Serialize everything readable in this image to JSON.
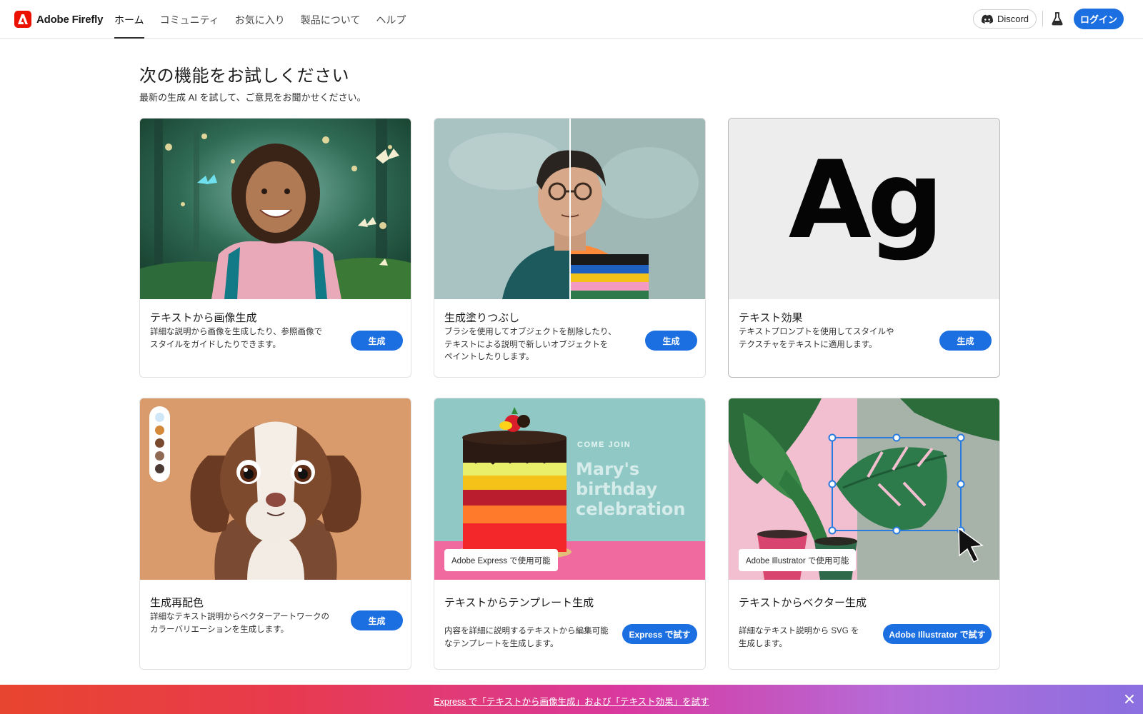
{
  "brand": {
    "name": "Adobe Firefly"
  },
  "nav": {
    "items": [
      {
        "label": "ホーム",
        "active": true
      },
      {
        "label": "コミュニティ",
        "active": false
      },
      {
        "label": "お気に入り",
        "active": false
      },
      {
        "label": "製品について",
        "active": false
      },
      {
        "label": "ヘルプ",
        "active": false
      }
    ]
  },
  "header": {
    "discord_label": "Discord",
    "login_label": "ログイン"
  },
  "page": {
    "title": "次の機能をお試しください",
    "subtitle": "最新の生成 AI を試して、ご意見をお聞かせください。"
  },
  "cards": [
    {
      "title": "テキストから画像生成",
      "desc": [
        "詳細な説明から画像を生成したり、参照画像で",
        "スタイルをガイドしたりできます。"
      ],
      "button": "生成"
    },
    {
      "title": "生成塗りつぶし",
      "desc": [
        "ブラシを使用してオブジェクトを削除したり、",
        "テキストによる説明で新しいオブジェクトを",
        "ペイントしたりします。"
      ],
      "button": "生成"
    },
    {
      "title": "テキスト効果",
      "desc": [
        "テキストプロンプトを使用してスタイルや",
        "テクスチャをテキストに適用します。"
      ],
      "button": "生成",
      "image_text": "Ag"
    },
    {
      "title": "生成再配色",
      "desc": [
        "詳細なテキスト説明からベクターアートワークの",
        "カラーバリエーションを生成します。"
      ],
      "button": "生成"
    },
    {
      "title": "テキストからテンプレート生成",
      "desc": [
        "内容を詳細に説明するテキストから編集可能",
        "なテンプレートを生成します。"
      ],
      "button": "Express で試す",
      "badge": "Adobe Express で使用可能",
      "image_text": {
        "small": "Come join",
        "big": [
          "Mary's",
          "birthday",
          "celebration"
        ]
      }
    },
    {
      "title": "テキストからベクター生成",
      "desc": [
        "詳細なテキスト説明から SVG を",
        "生成します。"
      ],
      "button": "Adobe Illustrator で試す",
      "badge": "Adobe Illustrator で使用可能"
    }
  ],
  "promo": {
    "link_text": "Express で「テキストから画像生成」および「テキスト効果」を試す"
  },
  "colors": {
    "accent": "#1c6fe0",
    "brand_red": "#eb1000",
    "recolor_swatches": [
      "#cfe6f7",
      "#d58a3a",
      "#7a4a2e",
      "#8f6a52",
      "#4a3a33"
    ]
  },
  "icons": [
    "adobe-logo-icon",
    "discord-icon",
    "flask-icon",
    "close-icon",
    "cursor-icon"
  ]
}
